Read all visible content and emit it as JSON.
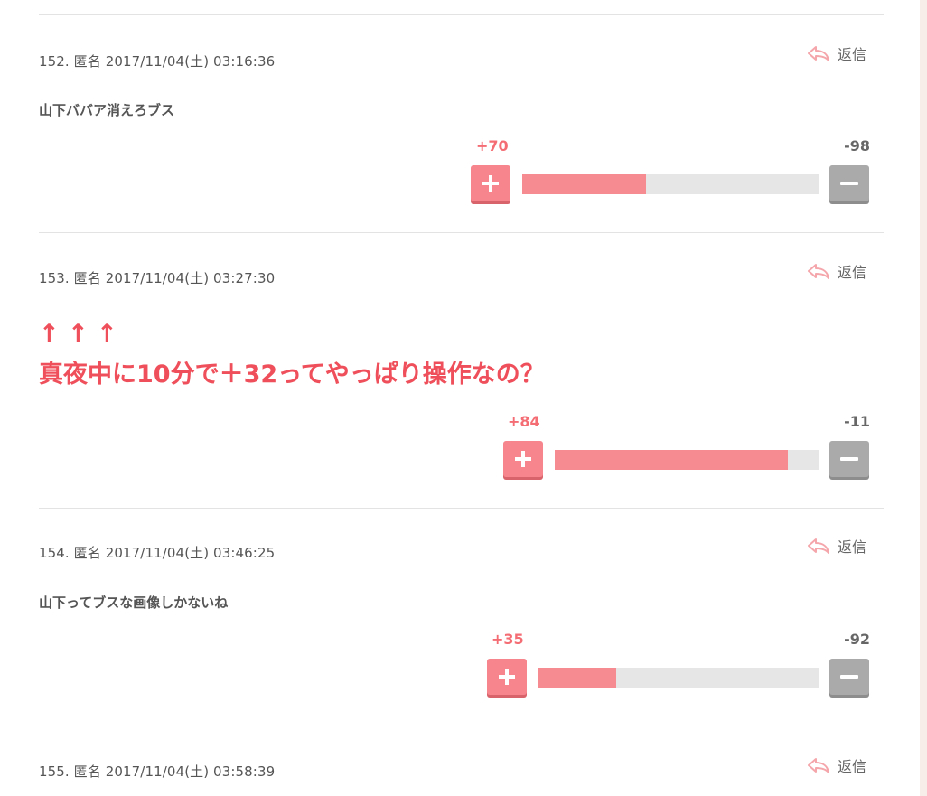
{
  "comments": [
    {
      "meta": "152. 匿名 2017/11/04(土) 03:16:36",
      "reply_label": "返信",
      "body": "山下ババア消えろブス",
      "plus": "+70",
      "minus": "-98",
      "plus_ratio": 0.417
    },
    {
      "meta": "153. 匿名 2017/11/04(土) 03:27:30",
      "reply_label": "返信",
      "body_line1": "↑ ↑ ↑",
      "body_line2": "真夜中に10分で＋32ってやっぱり操作なの？",
      "plus": "+84",
      "minus": "-11",
      "plus_ratio": 0.884
    },
    {
      "meta": "154. 匿名 2017/11/04(土) 03:46:25",
      "reply_label": "返信",
      "body": "山下ってブスな画像しかないね",
      "plus": "+35",
      "minus": "-92",
      "plus_ratio": 0.276
    },
    {
      "meta": "155. 匿名 2017/11/04(土) 03:58:39",
      "reply_label": "返信"
    }
  ],
  "icons": {
    "reply": "reply-arrow-icon",
    "plus": "plus-icon",
    "minus": "minus-icon"
  },
  "colors": {
    "plus": "#f6858d",
    "minus": "#aaaaaa",
    "highlight_text": "#ef4f5a"
  }
}
